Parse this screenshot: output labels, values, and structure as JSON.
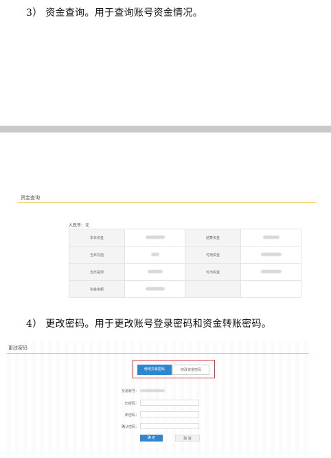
{
  "item3": {
    "heading": "3） 资金查询。用于查询账号资金情况。"
  },
  "funds_query": {
    "title": "资金查询",
    "currency_note": "人民币：元",
    "rows": [
      {
        "label_left": "本日资金",
        "label_right": "结算资金"
      },
      {
        "label_left": "当日充值",
        "label_right": "可用资金"
      },
      {
        "label_left": "当日提现",
        "label_right": "可出资金"
      },
      {
        "label_left": "资金余额",
        "label_right": ""
      }
    ]
  },
  "item4": {
    "heading": "4） 更改密码。用于更改账号登录密码和资金转账密码。"
  },
  "change_password": {
    "title": "更改密码",
    "tabs": [
      {
        "label": "修改交易密码",
        "active": true
      },
      {
        "label": "修改资金密码",
        "active": false
      }
    ],
    "account_label": "交易账号：",
    "fields": [
      {
        "label": "旧密码："
      },
      {
        "label": "新密码："
      },
      {
        "label": "确认密码："
      }
    ],
    "confirm_button": "确 定",
    "cancel_button": "取 消",
    "colors": {
      "accent": "#2f86d0",
      "highlight_border": "#d9363e",
      "divider": "#f0c040"
    }
  }
}
